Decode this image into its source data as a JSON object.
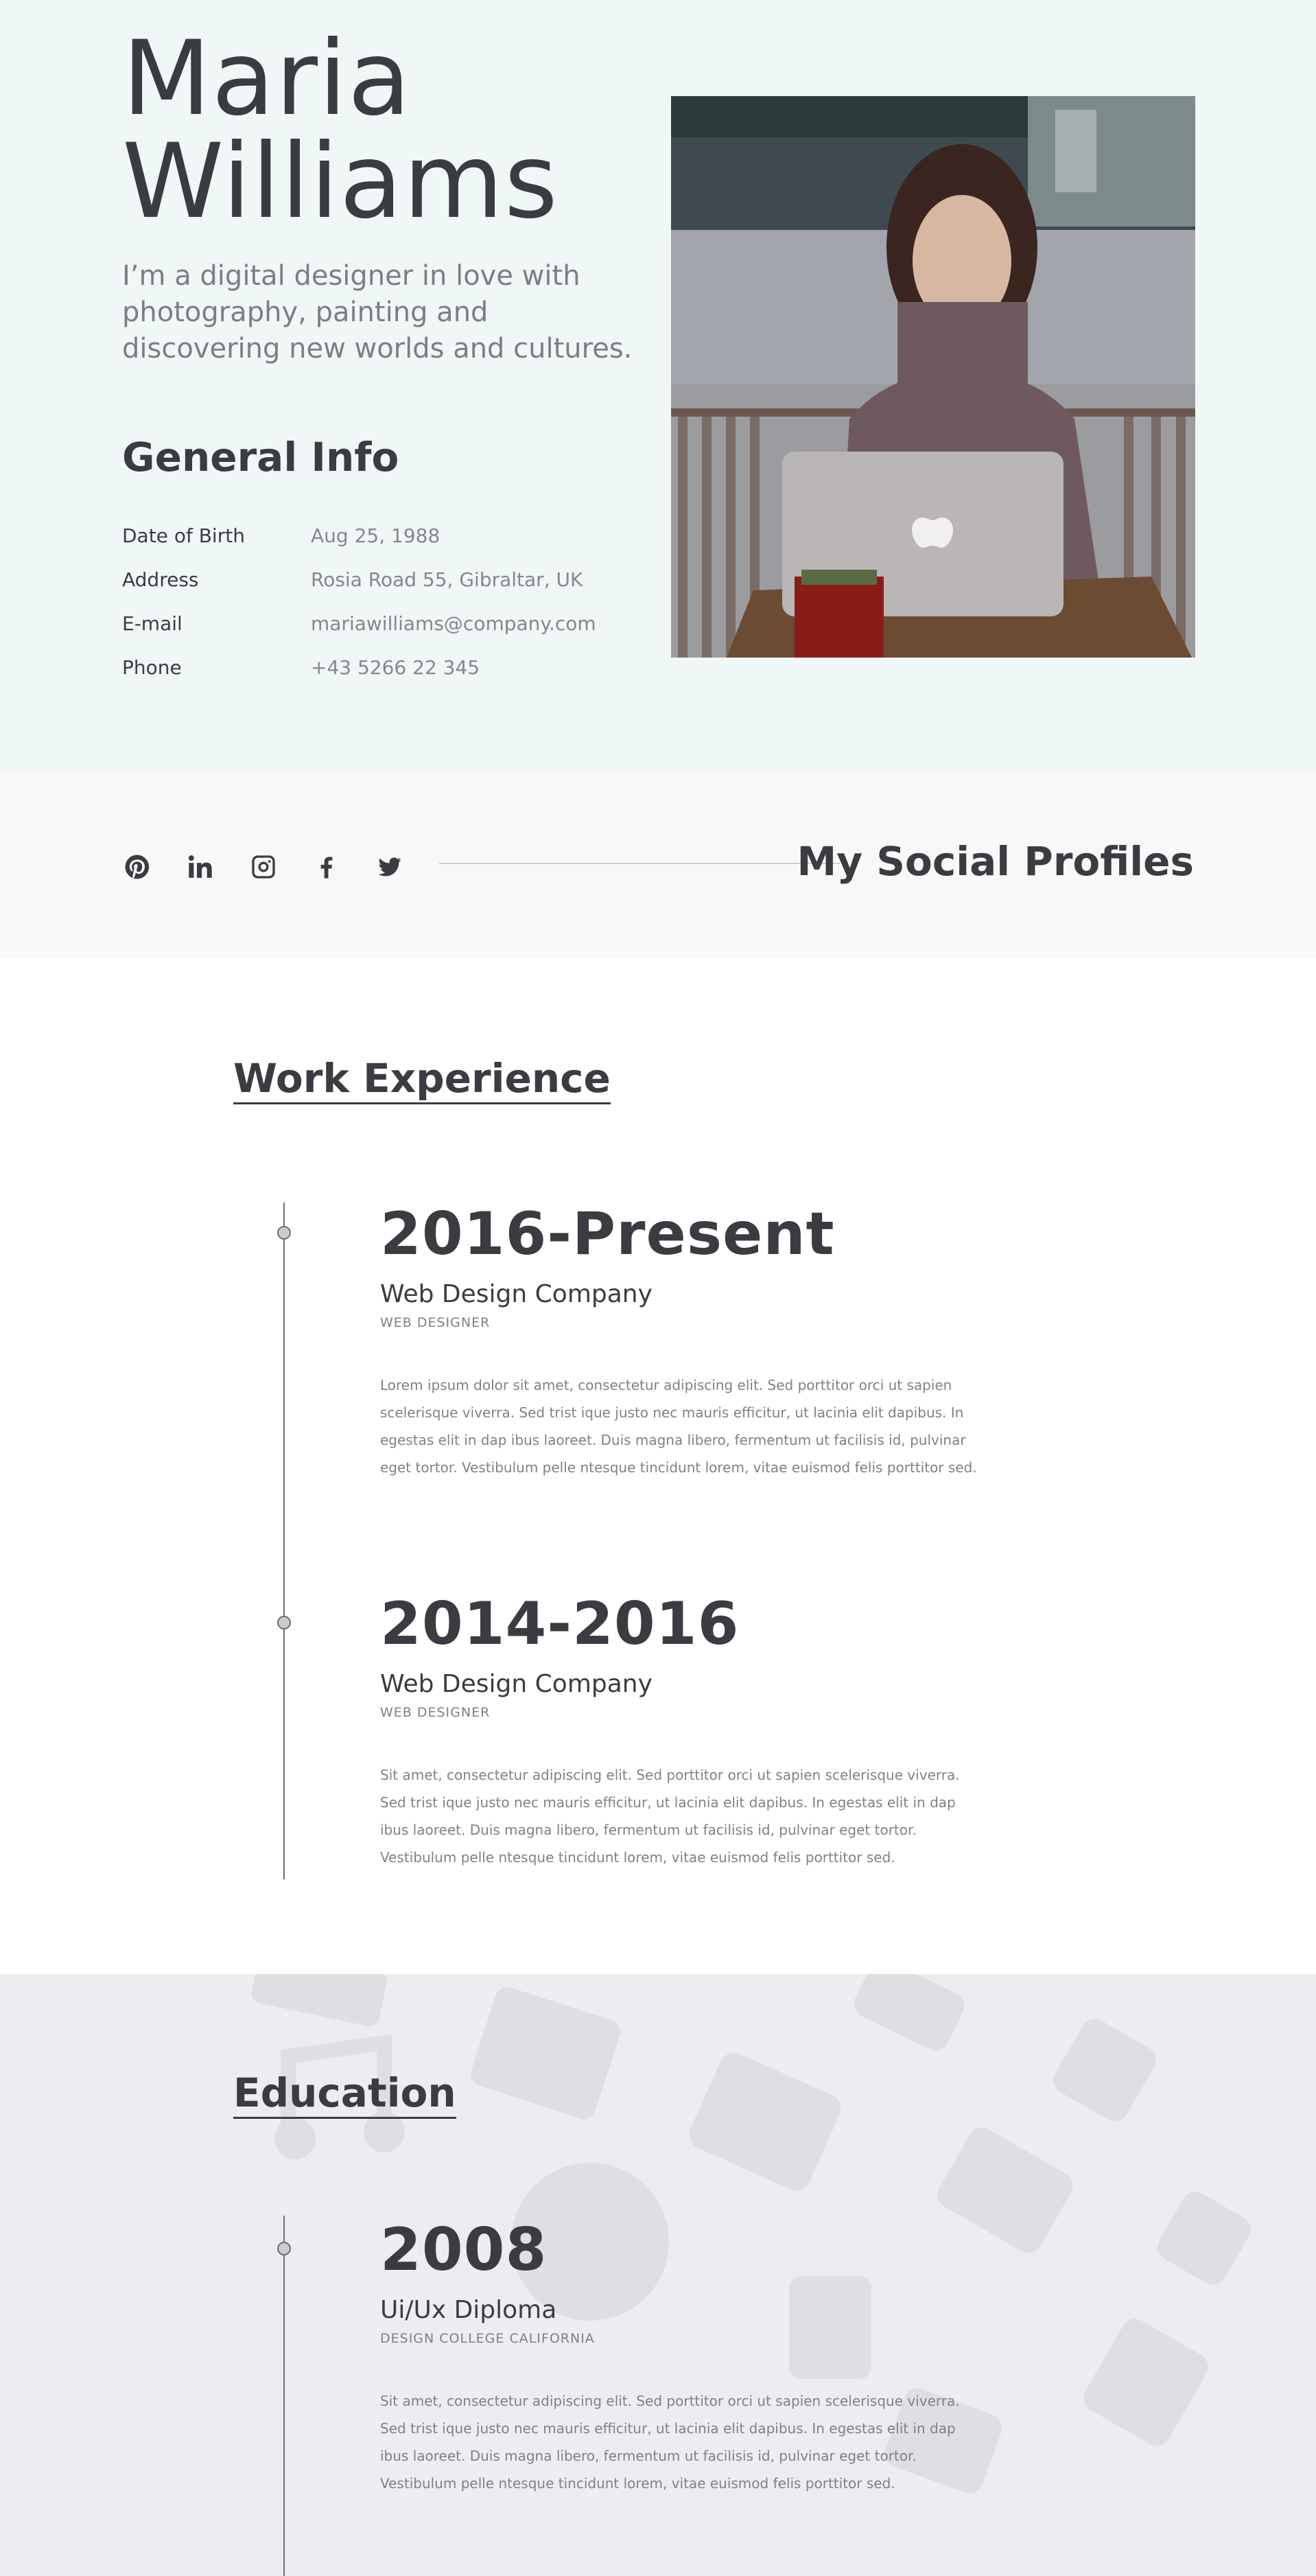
{
  "hero": {
    "name_line1": "Maria",
    "name_line2": "Williams",
    "bio": "I’m a digital designer in love with photography, painting and discovering new worlds and cultures."
  },
  "general_info": {
    "title": "General Info",
    "rows": [
      {
        "label": "Date of Birth",
        "value": "Aug 25, 1988"
      },
      {
        "label": "Address",
        "value": "Rosia Road 55, Gibraltar, UK"
      },
      {
        "label": "E-mail",
        "value": "mariawilliams@company.com"
      },
      {
        "label": "Phone",
        "value": "+43 5266 22 345"
      }
    ]
  },
  "social": {
    "title": "My Social Profiles",
    "icons": [
      "pinterest-icon",
      "linkedin-icon",
      "instagram-icon",
      "facebook-icon",
      "twitter-icon"
    ]
  },
  "work": {
    "title": "Work Experience",
    "entries": [
      {
        "year": "2016-Present",
        "company": "Web Design Company",
        "role": "WEB DESIGNER",
        "text": "Lorem ipsum dolor sit amet, consectetur adipiscing elit. Sed porttitor orci ut sapien scelerisque viverra. Sed trist ique justo nec mauris efficitur, ut lacinia elit dapibus. In egestas elit in dap ibus laoreet. Duis magna libero, fermentum ut facilisis id, pulvinar eget tortor. Vestibulum pelle ntesque tincidunt lorem, vitae euismod felis porttitor sed."
      },
      {
        "year": "2014-2016",
        "company": "Web Design Company",
        "role": "WEB DESIGNER",
        "text": "Sit amet, consectetur adipiscing elit. Sed porttitor orci ut sapien scelerisque viverra. Sed trist ique justo nec mauris efficitur, ut lacinia elit dapibus. In egestas elit in dap ibus laoreet. Duis magna libero, fermentum ut facilisis id, pulvinar eget tortor. Vestibulum pelle ntesque tincidunt lorem, vitae euismod felis porttitor sed."
      }
    ]
  },
  "education": {
    "title": "Education",
    "entries": [
      {
        "year": "2008",
        "degree": "Ui/Ux Diploma",
        "school": "DESIGN COLLEGE CALIFORNIA",
        "text": "Sit amet, consectetur adipiscing elit. Sed porttitor orci ut sapien scelerisque viverra. Sed trist ique justo nec mauris efficitur, ut lacinia elit dapibus. In egestas elit in dap ibus laoreet. Duis magna libero, fermentum ut facilisis id, pulvinar eget tortor. Vestibulum pelle ntesque tincidunt lorem, vitae euismod felis porttitor sed."
      }
    ]
  },
  "colors": {
    "hero_bg": "#f0f7f7",
    "social_bg": "#f8f8f8",
    "education_bg": "#ebedf0",
    "text_dark": "#3a3c42",
    "text_muted": "#7f8186"
  }
}
